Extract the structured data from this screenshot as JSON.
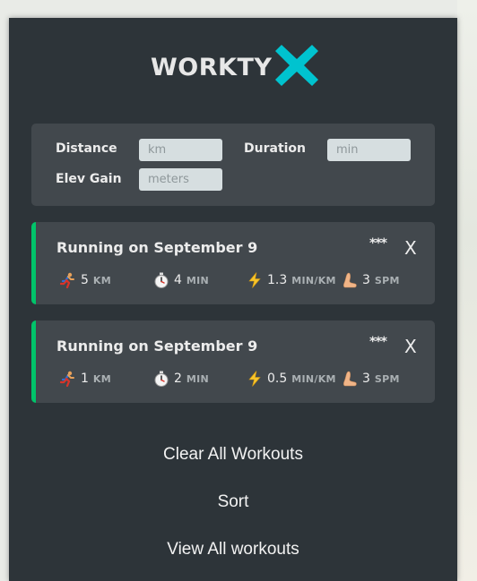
{
  "logo": {
    "text": "WORKTY"
  },
  "form": {
    "distance_label": "Distance",
    "distance_placeholder": "km",
    "duration_label": "Duration",
    "duration_placeholder": "min",
    "elev_label": "Elev Gain",
    "elev_placeholder": "meters"
  },
  "workouts": [
    {
      "title": "Running on September 9",
      "menu": "***",
      "close": "X",
      "distance": "5",
      "distance_unit": "KM",
      "duration": "4",
      "duration_unit": "MIN",
      "pace": "1.3",
      "pace_unit": "MIN/KM",
      "cadence": "3",
      "cadence_unit": "SPM"
    },
    {
      "title": "Running on September 9",
      "menu": "***",
      "close": "X",
      "distance": "1",
      "distance_unit": "KM",
      "duration": "2",
      "duration_unit": "MIN",
      "pace": "0.5",
      "pace_unit": "MIN/KM",
      "cadence": "3",
      "cadence_unit": "SPM"
    }
  ],
  "actions": {
    "clear_all": "Clear All Workouts",
    "sort": "Sort",
    "view_all": "View All workouts"
  },
  "colors": {
    "sidebar_bg": "#2d3439",
    "card_bg": "#42484d",
    "running_accent": "#00c46a",
    "logo_x": "#00c3cf"
  }
}
